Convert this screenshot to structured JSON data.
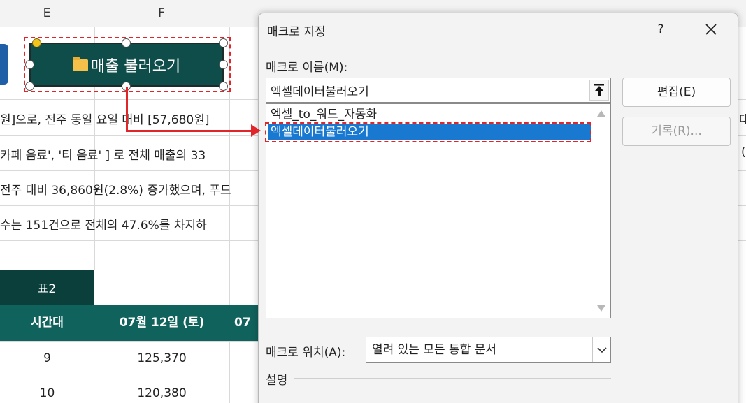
{
  "sheet": {
    "columns": [
      "E",
      "F"
    ],
    "macro_button_label": "매출 불러오기",
    "rows": [
      "원]으로, 전주 동일 요일 대비 [57,680원]",
      "카페 음료', '티 음료' ] 로 전체 매출의 33",
      "전주 대비 36,860원(2.8%) 증가했으며, 푸드",
      "수는 151건으로 전체의 47.6%를 차지하"
    ],
    "right_edge_fragments": [
      "대",
      "("
    ],
    "table": {
      "title": "표2",
      "headers": [
        "시간대",
        "07월 12일 (토)",
        "07"
      ],
      "rows": [
        [
          "9",
          "125,370"
        ],
        [
          "10",
          "120,380"
        ]
      ]
    }
  },
  "dialog": {
    "title": "매크로 지정",
    "help": "?",
    "name_label": "매크로 이름(M):",
    "name_value": "엑셀데이터불러오기",
    "macros": [
      "엑셀_to_워드_자동화",
      "엑셀데이터불러오기"
    ],
    "selected_index": 1,
    "edit_button": "편집(E)",
    "record_button": "기록(R)...",
    "location_label": "매크로 위치(A):",
    "location_value": "열려 있는 모든 통합 문서",
    "description_label": "설명"
  },
  "colors": {
    "button_fill": "#0f4d4a",
    "table_title_fill": "#0b3f3c",
    "table_header_fill": "#10625c",
    "annotation_red": "#e0262a",
    "selection_blue": "#1979d1"
  }
}
